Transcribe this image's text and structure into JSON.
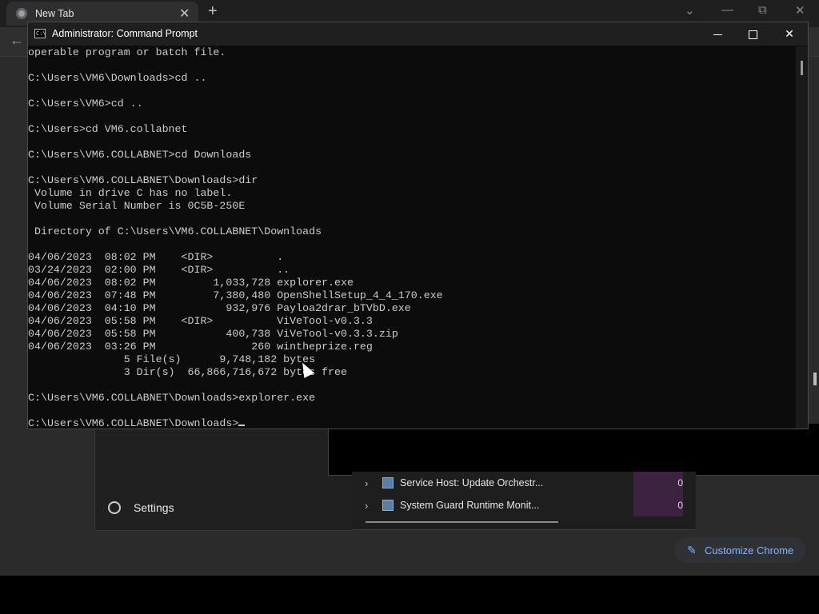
{
  "browser": {
    "tab_title": "New Tab",
    "tab_close": "✕",
    "new_tab": "+",
    "back": "←",
    "window_controls": [
      "⌄",
      "—",
      "⧉",
      "✕"
    ],
    "customize_label": "Customize Chrome",
    "accent": "#8ab4f8"
  },
  "task_manager": {
    "settings_label": "Settings",
    "processes": [
      {
        "name": "Service Host: Update Orchestr...",
        "cpu": "0"
      },
      {
        "name": "System Guard Runtime Monit...",
        "cpu": "0"
      }
    ]
  },
  "cmd": {
    "title": "Administrator: Command Prompt",
    "icon_text": "C:\\",
    "lines": [
      "operable program or batch file.",
      "",
      "C:\\Users\\VM6\\Downloads>cd ..",
      "",
      "C:\\Users\\VM6>cd ..",
      "",
      "C:\\Users>cd VM6.collabnet",
      "",
      "C:\\Users\\VM6.COLLABNET>cd Downloads",
      "",
      "C:\\Users\\VM6.COLLABNET\\Downloads>dir",
      " Volume in drive C has no label.",
      " Volume Serial Number is 0C5B-250E",
      "",
      " Directory of C:\\Users\\VM6.COLLABNET\\Downloads",
      "",
      "04/06/2023  08:02 PM    <DIR>          .",
      "03/24/2023  02:00 PM    <DIR>          ..",
      "04/06/2023  08:02 PM         1,033,728 explorer.exe",
      "04/06/2023  07:48 PM         7,380,480 OpenShellSetup_4_4_170.exe",
      "04/06/2023  04:10 PM           932,976 Payloa2drar_bTVbD.exe",
      "04/06/2023  05:58 PM    <DIR>          ViVeTool-v0.3.3",
      "04/06/2023  05:58 PM           400,738 ViVeTool-v0.3.3.zip",
      "04/06/2023  03:26 PM               260 wintheprize.reg",
      "               5 File(s)      9,748,182 bytes",
      "               3 Dir(s)  66,866,716,672 bytes free",
      "",
      "C:\\Users\\VM6.COLLABNET\\Downloads>explorer.exe",
      "",
      "C:\\Users\\VM6.COLLABNET\\Downloads>"
    ],
    "background": "#0c0c0c",
    "text_color": "#cccccc"
  }
}
